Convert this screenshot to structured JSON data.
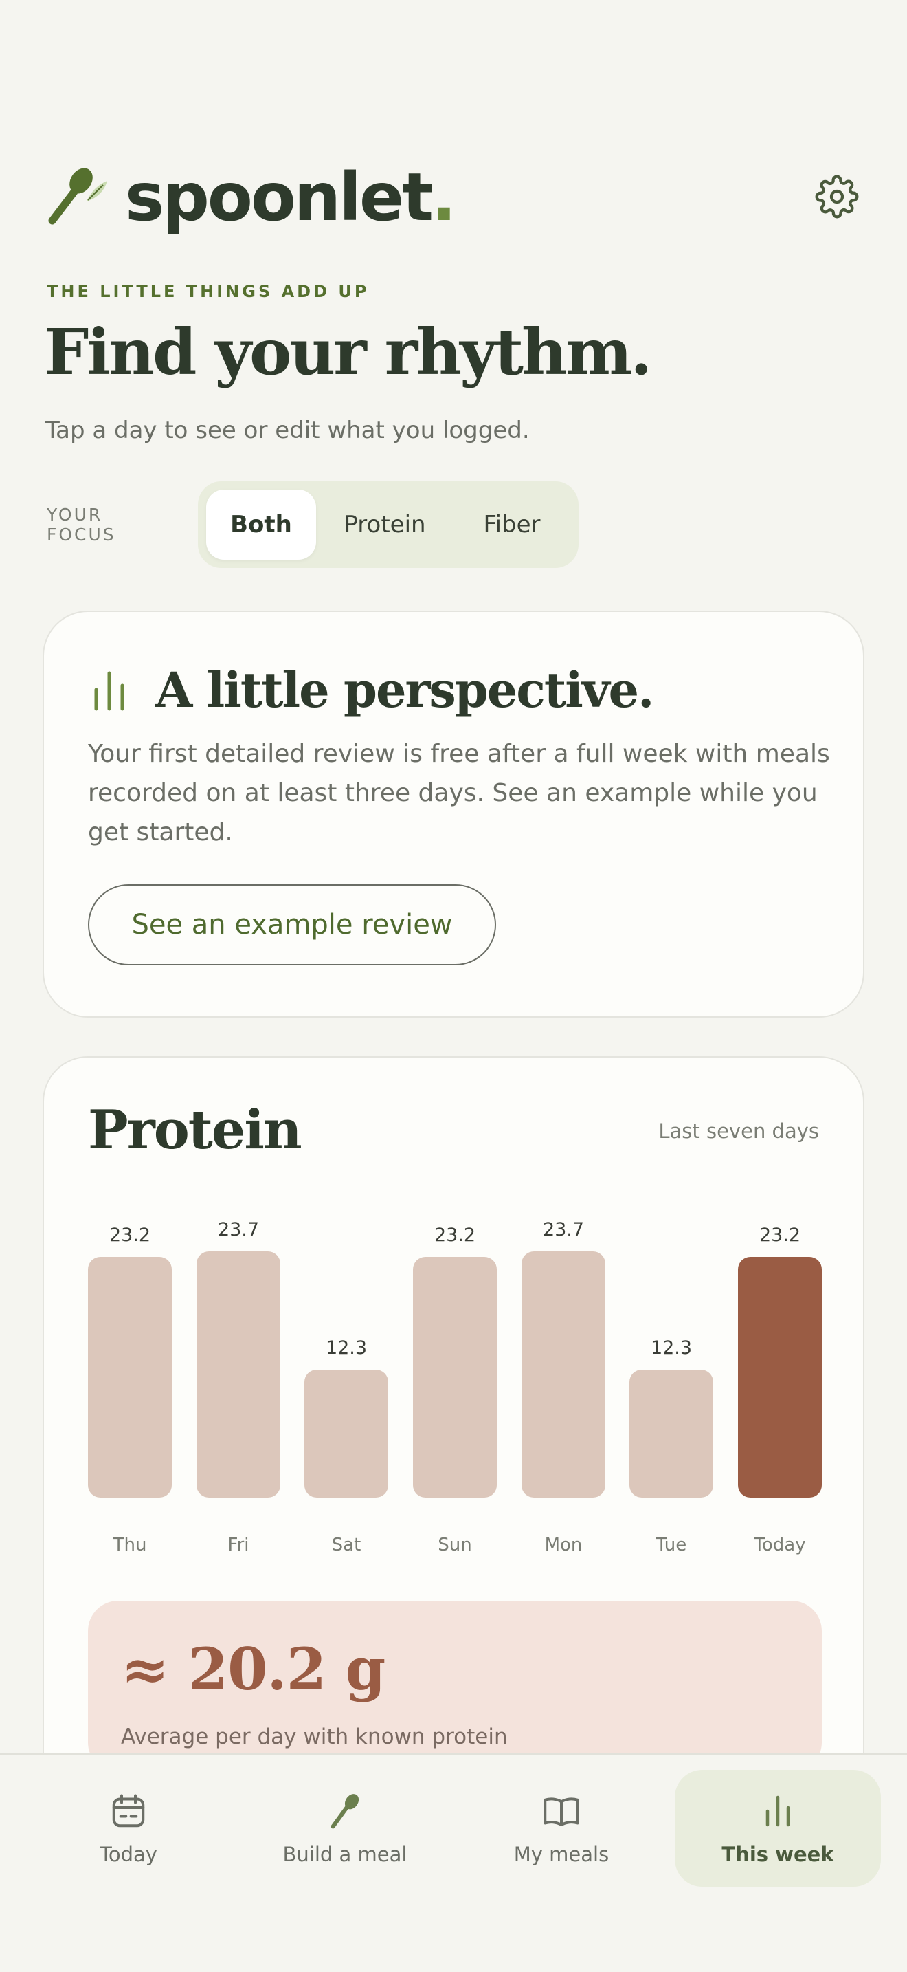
{
  "app": {
    "name": "spoonlet",
    "name_dot": ".",
    "accent": "#6d8a3f",
    "primary": "#2e3a2c"
  },
  "header": {
    "eyebrow": "THE LITTLE THINGS ADD UP",
    "headline": "Find your rhythm.",
    "subline": "Tap a day to see or edit what you logged.",
    "settings_icon": "gear-icon"
  },
  "focus": {
    "label": "YOUR FOCUS",
    "options": [
      "Both",
      "Protein",
      "Fiber"
    ],
    "selected": "Both"
  },
  "perspective_card": {
    "icon": "bar-chart-icon",
    "title": "A little perspective.",
    "body": "Your first detailed review is free after a full week with meals recorded on at least three days. See an example while you get started.",
    "button_label": "See an example review"
  },
  "protein_card": {
    "title": "Protein",
    "range_label": "Last seven days",
    "average_value": "≈ 20.2 g",
    "average_label": "Average per day with known protein"
  },
  "chart_data": {
    "type": "bar",
    "categories": [
      "Thu",
      "Fri",
      "Sat",
      "Sun",
      "Mon",
      "Tue",
      "Today"
    ],
    "values": [
      23.2,
      23.7,
      12.3,
      23.2,
      23.7,
      12.3,
      23.2
    ],
    "highlight_index": 6,
    "colors": {
      "default": "#dcc7bb",
      "highlight": "#9a5c44"
    },
    "title": "",
    "xlabel": "",
    "ylabel": "",
    "ylim": [
      0,
      23.7
    ],
    "grid": false
  },
  "bottom_nav": {
    "items": [
      {
        "label": "Today",
        "icon": "calendar-icon"
      },
      {
        "label": "Build a meal",
        "icon": "spoon-icon"
      },
      {
        "label": "My meals",
        "icon": "book-icon"
      },
      {
        "label": "This week",
        "icon": "bar-chart-icon"
      }
    ],
    "active": "This week"
  }
}
